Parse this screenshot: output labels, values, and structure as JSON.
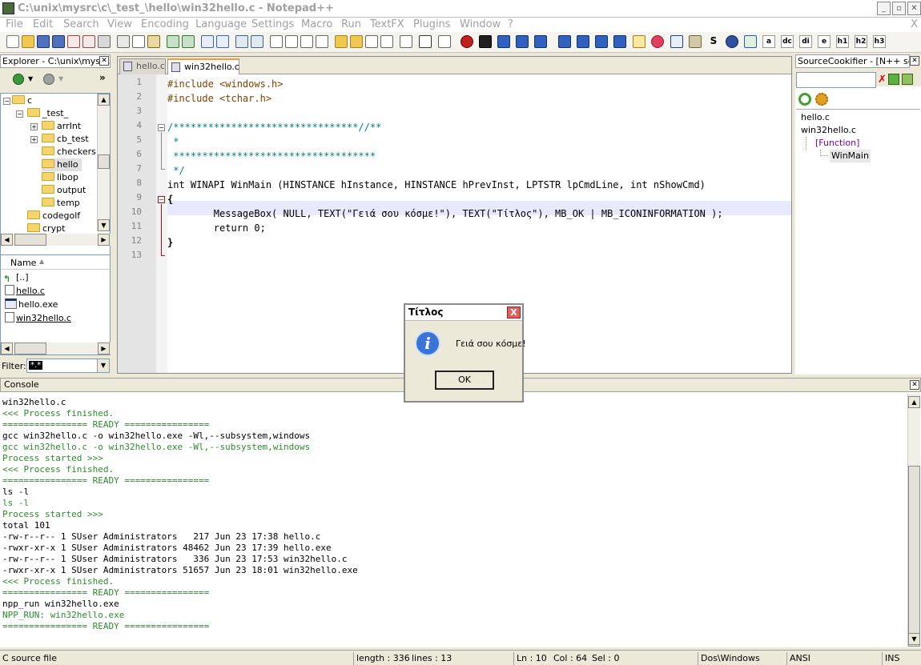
{
  "window": {
    "title": "C:\\unix\\mysrc\\c\\_test_\\hello\\win32hello.c - Notepad++"
  },
  "menu": [
    "File",
    "Edit",
    "Search",
    "View",
    "Encoding",
    "Language",
    "Settings",
    "Macro",
    "Run",
    "TextFX",
    "Plugins",
    "Window",
    "?"
  ],
  "menu_close": "X",
  "toolbar": {
    "text_buttons": [
      "S",
      "a",
      "dc",
      "di",
      "e",
      "h1",
      "h2",
      "h3"
    ]
  },
  "explorer": {
    "header": "Explorer - C:\\unix\\mysr...",
    "tree": [
      {
        "label": "c",
        "level": 0,
        "expander": "-"
      },
      {
        "label": "_test_",
        "level": 1,
        "expander": "-"
      },
      {
        "label": "arrInt",
        "level": 2,
        "expander": "+"
      },
      {
        "label": "cb_test",
        "level": 2,
        "expander": "+"
      },
      {
        "label": "checkers",
        "level": 2,
        "expander": ""
      },
      {
        "label": "hello",
        "level": 2,
        "expander": "",
        "selected": true
      },
      {
        "label": "libop",
        "level": 2,
        "expander": ""
      },
      {
        "label": "output",
        "level": 2,
        "expander": ""
      },
      {
        "label": "temp",
        "level": 2,
        "expander": ""
      },
      {
        "label": "codegolf",
        "level": 1,
        "expander": ""
      },
      {
        "label": "crypt",
        "level": 1,
        "expander": ""
      }
    ],
    "files_header": "Name",
    "files": [
      {
        "name": "[..]",
        "type": "up"
      },
      {
        "name": "hello.c",
        "type": "c"
      },
      {
        "name": "hello.exe",
        "type": "exe"
      },
      {
        "name": "win32hello.c",
        "type": "c"
      }
    ],
    "filter_label": "Filter:",
    "filter_value": "*.*"
  },
  "tabs": [
    {
      "label": "hello.c",
      "active": false
    },
    {
      "label": "win32hello.c",
      "active": true
    }
  ],
  "code": {
    "line_numbers": [
      "1",
      "2",
      "3",
      "4",
      "5",
      "6",
      "7",
      "8",
      "9",
      "10",
      "11",
      "12",
      "13"
    ],
    "lines": [
      "#include <windows.h>",
      "#include <tchar.h>",
      "",
      "/********************************//**",
      " *",
      " ***********************************",
      " */",
      "int WINAPI WinMain (HINSTANCE hInstance, HINSTANCE hPrevInst, LPTSTR lpCmdLine, int nShowCmd)",
      "{",
      "        MessageBox( NULL, TEXT(\"Γειά σου κόσμε!\"), TEXT(\"Τίτλος\"), MB_OK | MB_ICONINFORMATION );",
      "        return 0;",
      "}",
      ""
    ],
    "current_line": 10
  },
  "sourcecookifier": {
    "header": "SourceCookifier - [N++ sess...",
    "search_value": "",
    "items": [
      {
        "label": "hello.c",
        "level": 0
      },
      {
        "label": "win32hello.c",
        "level": 0
      },
      {
        "label": "[Function]",
        "level": 1
      },
      {
        "label": "WinMain",
        "level": 2
      }
    ]
  },
  "console": {
    "header": "Console",
    "lines": [
      {
        "text": "win32hello.c",
        "color": "black"
      },
      {
        "text": "<<< Process finished.",
        "color": "green"
      },
      {
        "text": "================ READY ================",
        "color": "green"
      },
      {
        "text": "gcc win32hello.c -o win32hello.exe -Wl,--subsystem,windows",
        "color": "black"
      },
      {
        "text": "gcc win32hello.c -o win32hello.exe -Wl,--subsystem,windows",
        "color": "green"
      },
      {
        "text": "Process started >>>",
        "color": "green"
      },
      {
        "text": "<<< Process finished.",
        "color": "green"
      },
      {
        "text": "================ READY ================",
        "color": "green"
      },
      {
        "text": "ls -l",
        "color": "black"
      },
      {
        "text": "ls -l",
        "color": "green"
      },
      {
        "text": "Process started >>>",
        "color": "green"
      },
      {
        "text": "total 101",
        "color": "black"
      },
      {
        "text": "-rw-r--r-- 1 SUser Administrators   217 Jun 23 17:38 hello.c",
        "color": "black"
      },
      {
        "text": "-rwxr-xr-x 1 SUser Administrators 48462 Jun 23 17:39 hello.exe",
        "color": "black"
      },
      {
        "text": "-rw-r--r-- 1 SUser Administrators   336 Jun 23 17:53 win32hello.c",
        "color": "black"
      },
      {
        "text": "-rwxr-xr-x 1 SUser Administrators 51657 Jun 23 18:01 win32hello.exe",
        "color": "black"
      },
      {
        "text": "<<< Process finished.",
        "color": "green"
      },
      {
        "text": "================ READY ================",
        "color": "green"
      },
      {
        "text": "npp_run win32hello.exe",
        "color": "black"
      },
      {
        "text": "NPP_RUN: win32hello.exe",
        "color": "green"
      },
      {
        "text": "================ READY ================",
        "color": "green"
      }
    ]
  },
  "status": {
    "file_type": "C source file",
    "length": "length : 336",
    "lines": "lines : 13",
    "ln": "Ln : 10",
    "col": "Col : 64",
    "sel": "Sel : 0",
    "eol": "Dos\\Windows",
    "encoding": "ANSI",
    "mode": "INS"
  },
  "dialog": {
    "title": "Τίτλος",
    "message": "Γειά σου κόσμε!",
    "ok_label": "OK",
    "close_label": "X"
  }
}
